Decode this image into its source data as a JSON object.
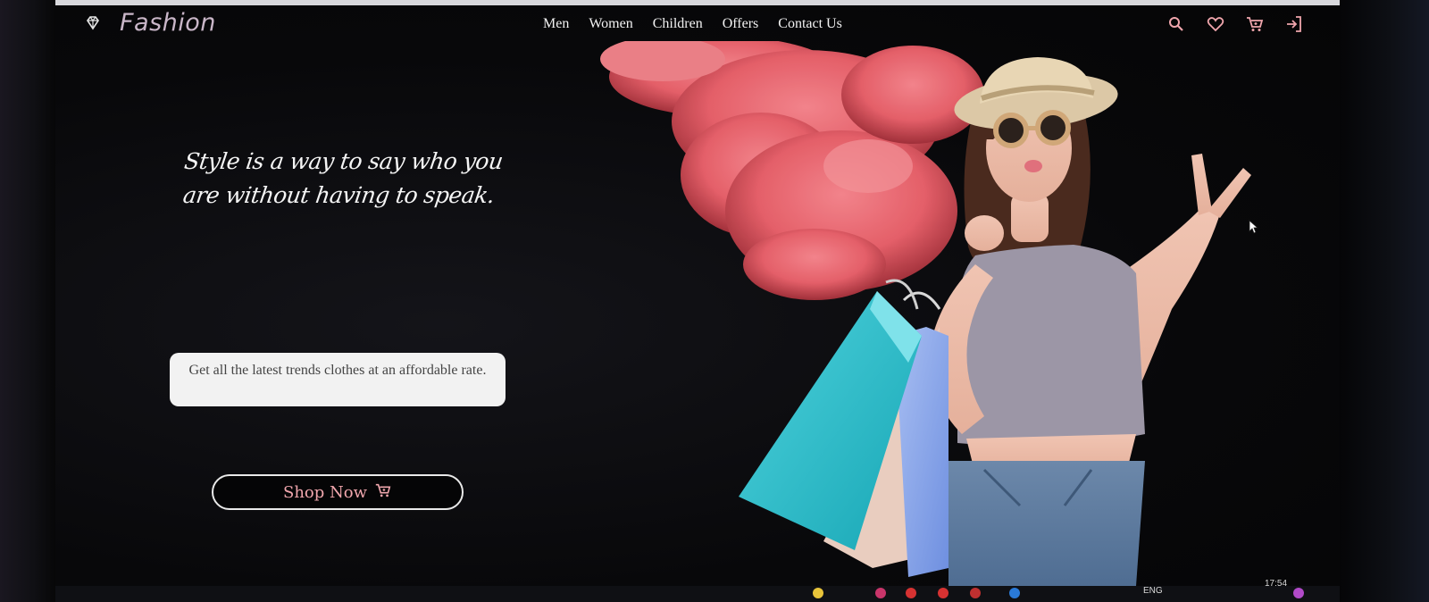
{
  "brand": {
    "name": "Fashion",
    "logo_icon": "diamond-icon"
  },
  "nav": {
    "items": [
      {
        "label": "Men"
      },
      {
        "label": "Women"
      },
      {
        "label": "Children"
      },
      {
        "label": "Offers"
      },
      {
        "label": "Contact Us"
      }
    ],
    "actions": [
      "search-icon",
      "heart-icon",
      "cart-icon",
      "sign-in-icon"
    ]
  },
  "hero": {
    "tagline_line1": "Style is a way to say who you",
    "tagline_line2": "are without having to speak.",
    "promo_text": "Get all the latest trends clothes at an affordable rate.",
    "cta_label": "Shop Now",
    "cta_icon": "cart-icon"
  },
  "taskbar": {
    "language": "ENG",
    "time": "17:54"
  },
  "colors": {
    "accent": "#f0a6ad",
    "brand": "#c9b6c8",
    "background": "#08080a",
    "smoke": "#f36b74",
    "bag_teal": "#2bbcc8",
    "bag_blue": "#7f9fe6"
  }
}
